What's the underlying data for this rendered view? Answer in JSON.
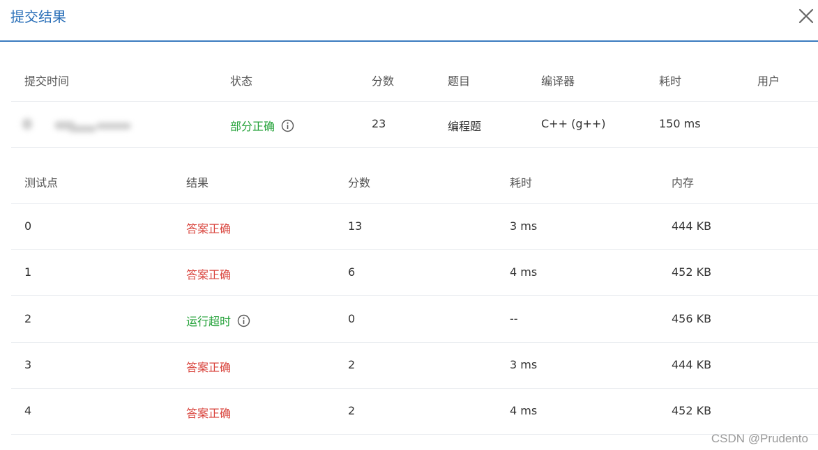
{
  "dialog": {
    "title": "提交结果"
  },
  "submission": {
    "headers": {
      "time": "提交时间",
      "status": "状态",
      "score": "分数",
      "problem": "题目",
      "compiler": "编译器",
      "time_used": "耗时",
      "user": "用户"
    },
    "row": {
      "status": "部分正确",
      "score": "23",
      "problem": "编程题",
      "compiler": "C++ (g++)",
      "time_used": "150 ms"
    }
  },
  "testcases": {
    "headers": {
      "case": "测试点",
      "result": "结果",
      "score": "分数",
      "time": "耗时",
      "memory": "内存"
    },
    "rows": [
      {
        "case": "0",
        "result": "答案正确",
        "score": "13",
        "time": "3 ms",
        "memory": "444 KB"
      },
      {
        "case": "1",
        "result": "答案正确",
        "score": "6",
        "time": "4 ms",
        "memory": "452 KB"
      },
      {
        "case": "2",
        "result": "运行超时",
        "score": "0",
        "time": "--",
        "memory": "456 KB"
      },
      {
        "case": "3",
        "result": "答案正确",
        "score": "2",
        "time": "3 ms",
        "memory": "444 KB"
      },
      {
        "case": "4",
        "result": "答案正确",
        "score": "2",
        "time": "4 ms",
        "memory": "452 KB"
      }
    ]
  },
  "colors": {
    "accent": "#2a6fb8",
    "partial_correct": "#26a33b",
    "accepted": "#d9453e",
    "time_limit_exceeded": "#26a33b"
  },
  "watermark": "CSDN @Prudento"
}
